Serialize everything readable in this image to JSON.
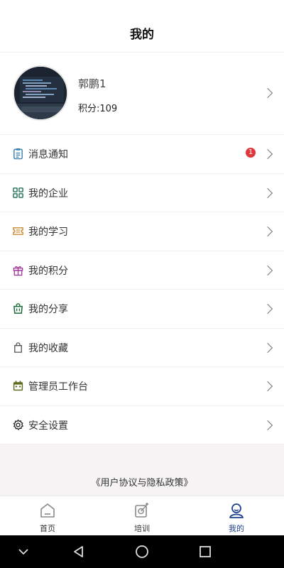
{
  "header": {
    "title": "我的"
  },
  "profile": {
    "name": "郭鹏1",
    "points": "积分:109"
  },
  "menu": [
    {
      "label": "消息通知",
      "icon": "clipboard-icon",
      "badge": "1"
    },
    {
      "label": "我的企业",
      "icon": "grid-icon"
    },
    {
      "label": "我的学习",
      "icon": "ticket-icon"
    },
    {
      "label": "我的积分",
      "icon": "gift-icon"
    },
    {
      "label": "我的分享",
      "icon": "bag-icon"
    },
    {
      "label": "我的收藏",
      "icon": "bookmark-bag-icon"
    },
    {
      "label": "管理员工作台",
      "icon": "calendar-icon"
    },
    {
      "label": "安全设置",
      "icon": "gear-icon"
    }
  ],
  "footer": {
    "policy_link": "《用户协议与隐私政策》"
  },
  "tabbar": {
    "items": [
      {
        "label": "首页",
        "icon": "home-icon"
      },
      {
        "label": "培训",
        "icon": "training-icon"
      },
      {
        "label": "我的",
        "icon": "user-icon",
        "active": true
      }
    ]
  },
  "colors": {
    "accent": "#1f3f8f",
    "badge": "#e0363c",
    "icon_blue": "#3b7fb0",
    "icon_green": "#2f7a5f",
    "icon_orange": "#c98a2e",
    "icon_purple": "#a03a9a",
    "icon_darkgreen": "#1e6b3a",
    "icon_olive": "#5c6b1e"
  }
}
